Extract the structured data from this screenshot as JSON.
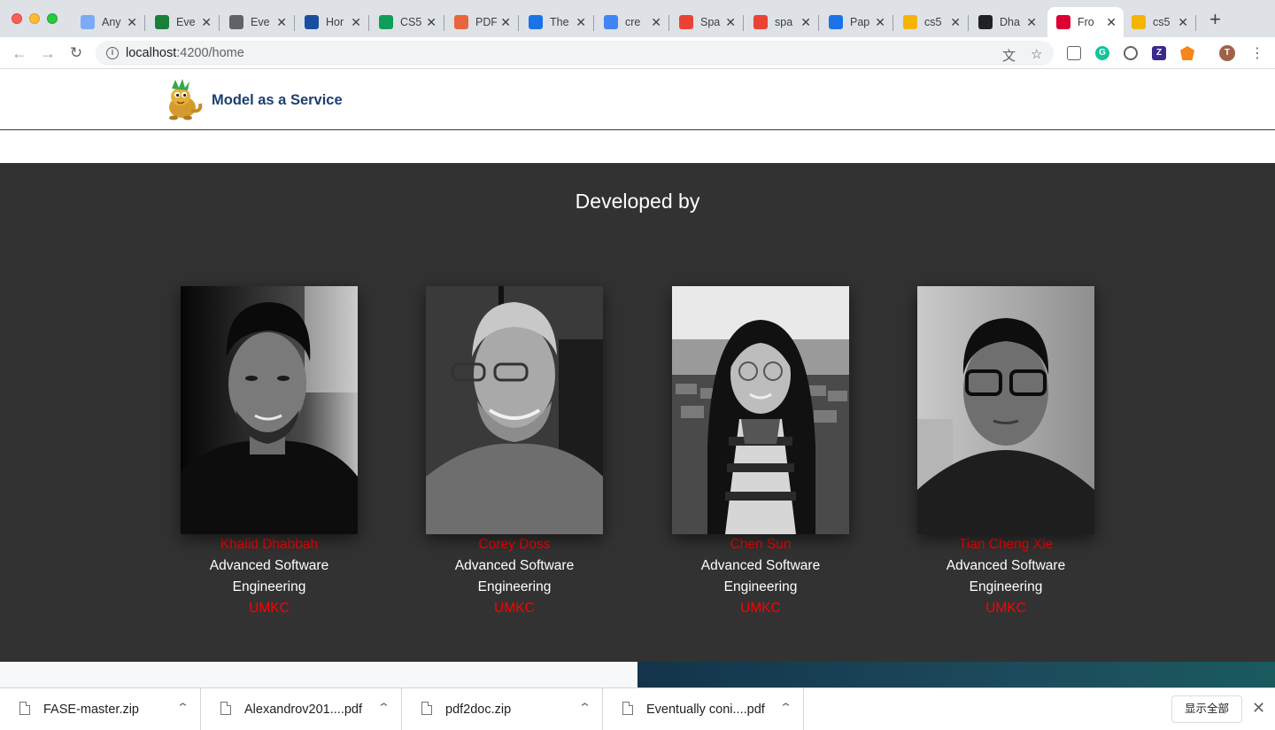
{
  "browser": {
    "tabs": [
      {
        "title": "Any",
        "icon": "document-icon",
        "color": "#7baaf7"
      },
      {
        "title": "Eve",
        "icon": "gear-green-icon",
        "color": "#188038"
      },
      {
        "title": "Eve",
        "icon": "globe-icon",
        "color": "#5f6368"
      },
      {
        "title": "Hor",
        "icon": "flag-icon",
        "color": "#1a4fa0"
      },
      {
        "title": "CS5",
        "icon": "sheets-icon",
        "color": "#0f9d58"
      },
      {
        "title": "PDF",
        "icon": "pdf-icon",
        "color": "#e8663d"
      },
      {
        "title": "The",
        "icon": "flask-icon",
        "color": "#1a73e8"
      },
      {
        "title": "cre",
        "icon": "google-icon",
        "color": "#4285f4"
      },
      {
        "title": "Spa",
        "icon": "jianshu-icon",
        "color": "#ea4335"
      },
      {
        "title": "spa",
        "icon": "jianshu-icon",
        "color": "#ea4335"
      },
      {
        "title": "Pap",
        "icon": "umkc-icon",
        "color": "#1a73e8"
      },
      {
        "title": "cs5",
        "icon": "slides-icon",
        "color": "#f4b400"
      },
      {
        "title": "Dha",
        "icon": "github-icon",
        "color": "#202124"
      },
      {
        "title": "Fro",
        "icon": "angular-icon",
        "color": "#dd0031"
      },
      {
        "title": "cs5",
        "icon": "slides-icon",
        "color": "#f4b400"
      }
    ],
    "active_tab_index": 13,
    "url_host": "localhost",
    "url_rest": ":4200/home",
    "profile_initial": "T"
  },
  "app": {
    "brand": "Model as a Service"
  },
  "team": {
    "title": "Developed by",
    "members": [
      {
        "name": "Khalid Dhabbah",
        "role": "Advanced Software Engineering",
        "org": "UMKC"
      },
      {
        "name": "Corey Doss",
        "role": "Advanced Software Engineering",
        "org": "UMKC"
      },
      {
        "name": "Chen Sun",
        "role": "Advanced Software Engineering",
        "org": "UMKC"
      },
      {
        "name": "Tian Cheng Xie",
        "role": "Advanced Software Engineering",
        "org": "UMKC"
      }
    ]
  },
  "downloads": {
    "items": [
      {
        "name": "FASE-master.zip"
      },
      {
        "name": "Alexandrov201....pdf"
      },
      {
        "name": "pdf2doc.zip"
      },
      {
        "name": "Eventually coni....pdf"
      }
    ],
    "show_all": "显示全部"
  }
}
